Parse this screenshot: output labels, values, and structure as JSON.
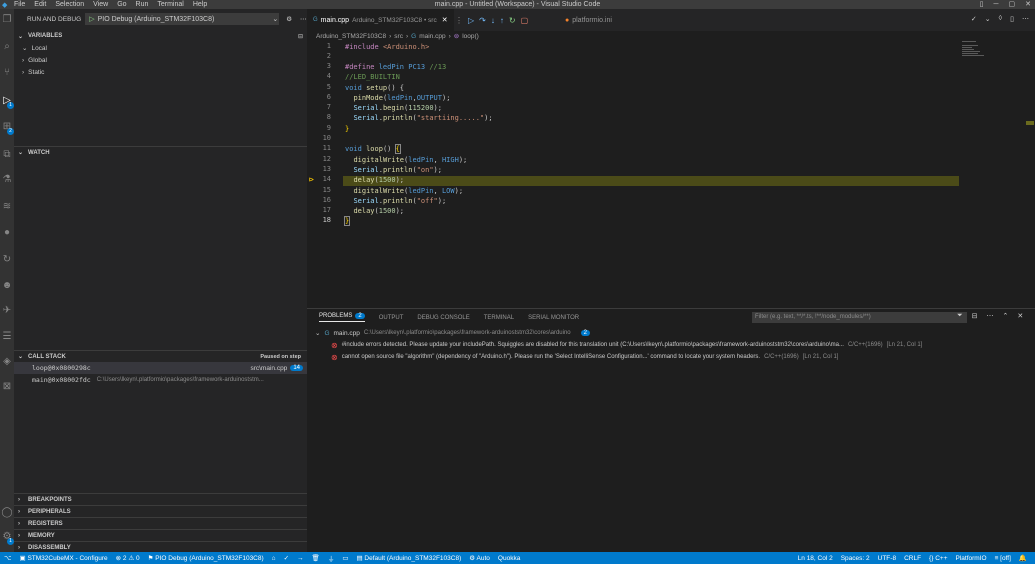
{
  "window": {
    "title": "main.cpp - Untitled (Workspace) - Visual Studio Code",
    "menu": [
      "File",
      "Edit",
      "Selection",
      "View",
      "Go",
      "Run",
      "Terminal",
      "Help"
    ]
  },
  "sidebar": {
    "header": "RUN AND DEBUG",
    "config": "PIO Debug (Arduino_STM32F103C8)",
    "variables_title": "VARIABLES",
    "variables": [
      "Local",
      "Global",
      "Static"
    ],
    "watch_title": "WATCH",
    "callstack_title": "CALL STACK",
    "callstack_status": "Paused on step",
    "callstack": [
      {
        "frame": "loop@0x0800298c",
        "file": "src\\main.cpp",
        "line": "14"
      },
      {
        "frame": "main@0x08002fdc",
        "file": "C:\\Users\\lkeyn\\.platformio\\packages\\framework-arduinoststm..."
      }
    ],
    "bottom_sections": [
      "BREAKPOINTS",
      "PERIPHERALS",
      "REGISTERS",
      "MEMORY",
      "DISASSEMBLY"
    ]
  },
  "editor": {
    "tabs": [
      {
        "name": "main.cpp",
        "desc": "Arduino_STM32F103C8 • src"
      },
      {
        "name": "platformio.ini",
        "desc": ""
      }
    ],
    "breadcrumb": [
      "Arduino_STM32F103C8",
      "src",
      "main.cpp",
      "loop()"
    ],
    "current_line": "18",
    "line_numbers": [
      "1",
      "2",
      "3",
      "4",
      "5",
      "6",
      "7",
      "8",
      "9",
      "10",
      "11",
      "12",
      "13",
      "14",
      "15",
      "16",
      "17",
      "18"
    ],
    "code": {
      "l1a": "#include ",
      "l1b": "<Arduino.h>",
      "l3a": "#define ",
      "l3b": "ledPin ",
      "l3c": "PC13 ",
      "l3d": "//13",
      "l4": "//LED_BUILTIN",
      "l5a": "void ",
      "l5b": "setup",
      "l5c": "() {",
      "l6a": "  ",
      "l6b": "pinMode",
      "l6c": "(",
      "l6d": "ledPin",
      "l6e": ",",
      "l6f": "OUTPUT",
      "l6g": ");",
      "l7a": "  ",
      "l7b": "Serial",
      "l7c": ".",
      "l7d": "begin",
      "l7e": "(",
      "l7f": "115200",
      "l7g": ");",
      "l8a": "  ",
      "l8b": "Serial",
      "l8c": ".",
      "l8d": "println",
      "l8e": "(",
      "l8f": "\"startiing.....\"",
      "l8g": ");",
      "l9": "}",
      "l11a": "void ",
      "l11b": "loop",
      "l11c": "() ",
      "l11d": "{",
      "l12a": "  ",
      "l12b": "digitalWrite",
      "l12c": "(",
      "l12d": "ledPin",
      "l12e": ", ",
      "l12f": "HIGH",
      "l12g": ");",
      "l13a": "  ",
      "l13b": "Serial",
      "l13c": ".",
      "l13d": "println",
      "l13e": "(",
      "l13f": "\"on\"",
      "l13g": ");",
      "l14a": "  ",
      "l14b": "delay",
      "l14c": "(",
      "l14d": "1500",
      "l14e": ");",
      "l15a": "  ",
      "l15b": "digitalWrite",
      "l15c": "(",
      "l15d": "ledPin",
      "l15e": ", ",
      "l15f": "LOW",
      "l15g": ");",
      "l16a": "  ",
      "l16b": "Serial",
      "l16c": ".",
      "l16d": "println",
      "l16e": "(",
      "l16f": "\"off\"",
      "l16g": ");",
      "l17a": "  ",
      "l17b": "delay",
      "l17c": "(",
      "l17d": "1500",
      "l17e": ");",
      "l18": "}"
    }
  },
  "panel": {
    "tabs": [
      "PROBLEMS",
      "OUTPUT",
      "DEBUG CONSOLE",
      "TERMINAL",
      "SERIAL MONITOR"
    ],
    "problems_count": "2",
    "filter_placeholder": "Filter (e.g. text, **/*.ts, !**/node_modules/**)",
    "file": "main.cpp",
    "file_path": "C:\\Users\\lkeyn\\.platformio\\packages\\framework-arduinoststm32\\cores\\arduino",
    "file_count": "2",
    "problems": [
      {
        "msg": "#include errors detected. Please update your includePath. Squiggles are disabled for this translation unit (C:\\Users\\lkeyn\\.platformio\\packages\\framework-arduinoststm32\\cores\\arduino\\ma...",
        "src": "C/C++(1696)",
        "pos": "[Ln 21, Col 1]"
      },
      {
        "msg": "cannot open source file \"algorithm\" (dependency of \"Arduino.h\"). Please run the 'Select IntelliSense Configuration...' command to locate your system headers.",
        "src": "C/C++(1696)",
        "pos": "[Ln 21, Col 1]"
      }
    ]
  },
  "statusbar": {
    "cube": "STM32CubeMX - Configure",
    "errors": "2",
    "warnings": "0",
    "debug": "PIO Debug (Arduino_STM32F103C8)",
    "env": "Default (Arduino_STM32F103C8)",
    "auto": "Auto",
    "quokka": "Quokka",
    "position": "Ln 18, Col 2",
    "spaces": "Spaces: 2",
    "encoding": "UTF-8",
    "eol": "CRLF",
    "lang": "C++",
    "platform": "PlatformIO",
    "off": "[off]"
  },
  "colors": {
    "accent": "#007acc",
    "error": "#f14c4c",
    "debug_line": "#4b4b18"
  }
}
